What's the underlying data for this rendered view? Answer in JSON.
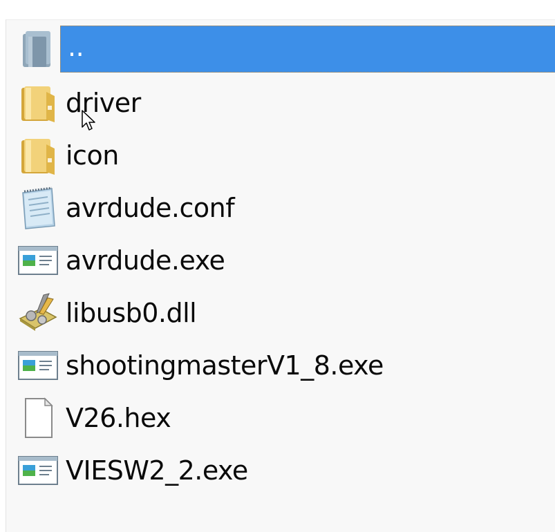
{
  "file_list": {
    "items": [
      {
        "label": "..",
        "icon": "folder-up-icon",
        "selected": true
      },
      {
        "label": "driver",
        "icon": "folder-icon",
        "selected": false
      },
      {
        "label": "icon",
        "icon": "folder-icon",
        "selected": false
      },
      {
        "label": "avrdude.conf",
        "icon": "notepad-file-icon",
        "selected": false
      },
      {
        "label": "avrdude.exe",
        "icon": "application-icon",
        "selected": false
      },
      {
        "label": "libusb0.dll",
        "icon": "dll-file-icon",
        "selected": false
      },
      {
        "label": "shootingmasterV1_8.exe",
        "icon": "application-icon",
        "selected": false
      },
      {
        "label": "V26.hex",
        "icon": "blank-file-icon",
        "selected": false
      },
      {
        "label": "VIESW2_2.exe",
        "icon": "application-icon",
        "selected": false
      }
    ]
  },
  "colors": {
    "selection": "#3d8fe8",
    "focus_border": "#d48a2a",
    "folder": "#e8c25a",
    "panel_background": "#f8f8f8"
  }
}
